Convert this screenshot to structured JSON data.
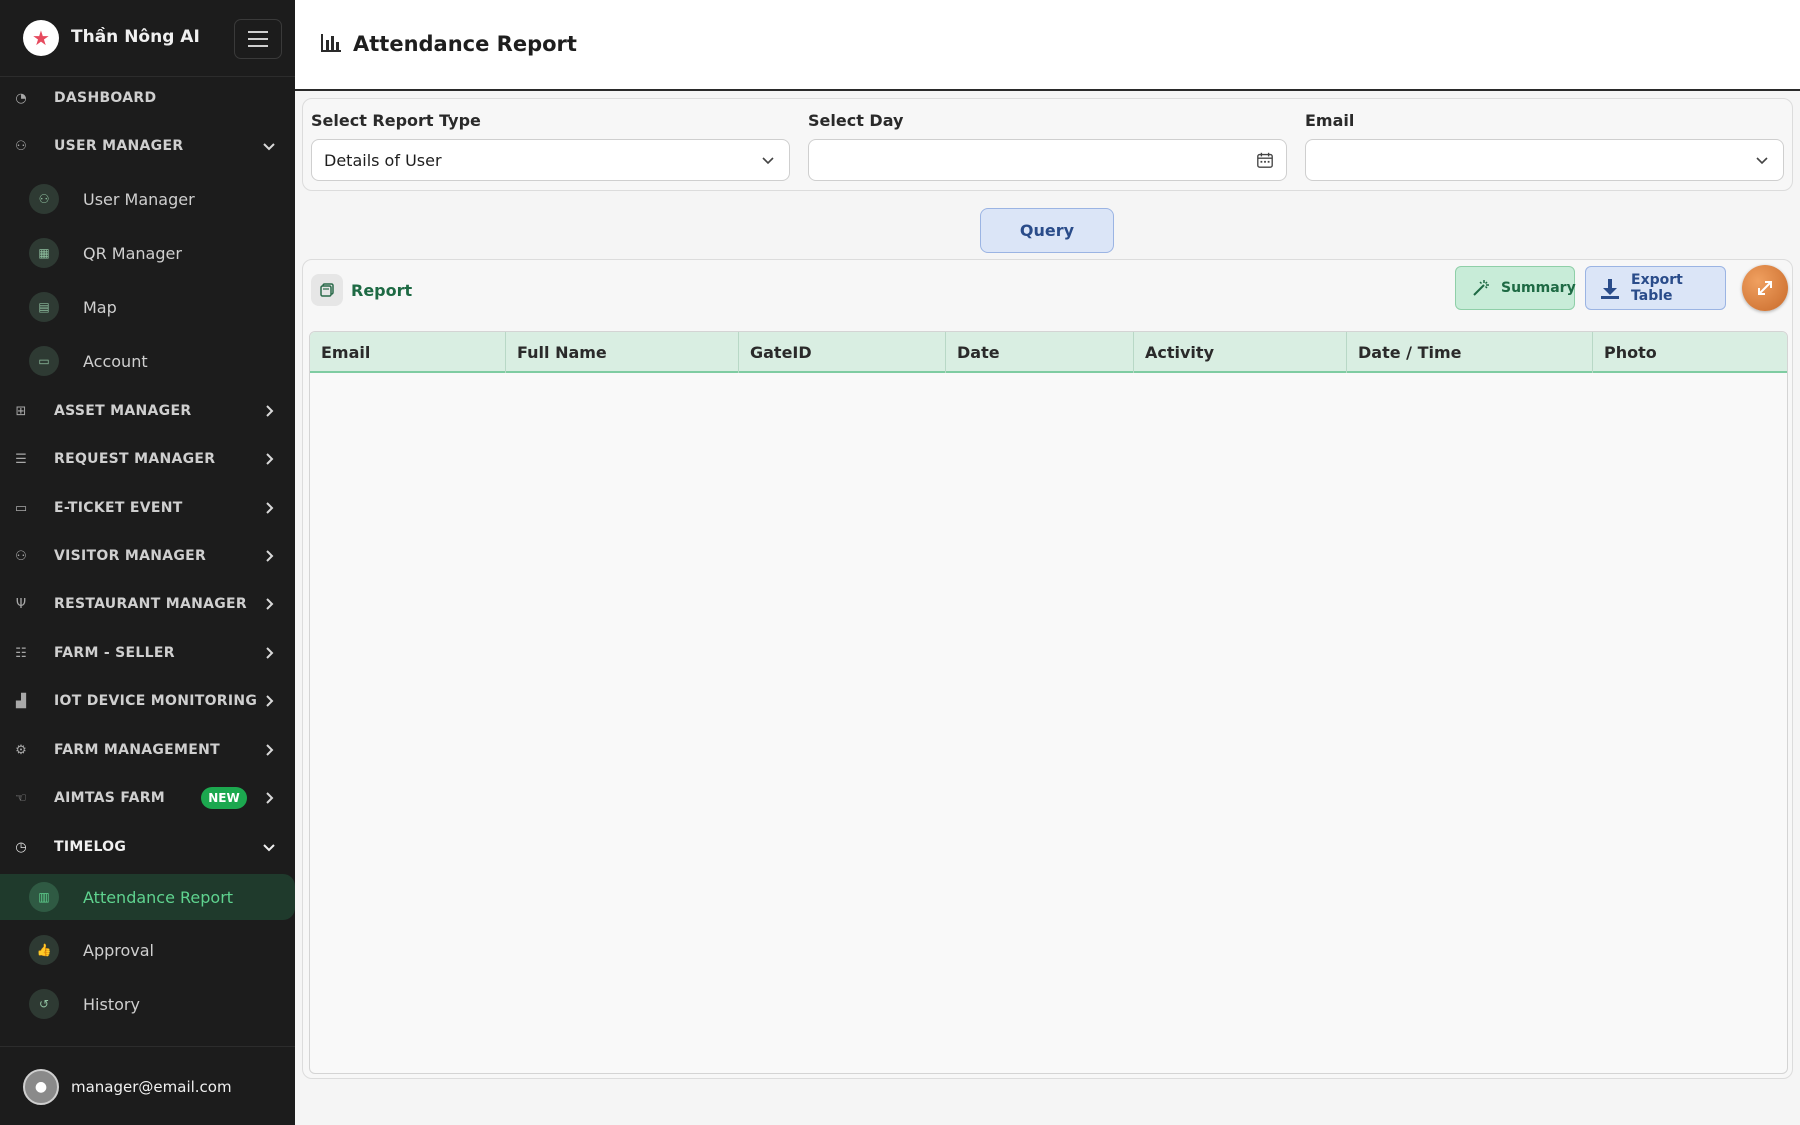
{
  "brand": {
    "name": "Thần Nông AI"
  },
  "sidebar": {
    "items": [
      {
        "label": "DASHBOARD",
        "icon": "gauge-icon"
      },
      {
        "label": "USER MANAGER",
        "icon": "users-icon",
        "expanded": true
      },
      {
        "label": "ASSET MANAGER",
        "icon": "sitemap-icon"
      },
      {
        "label": "REQUEST MANAGER",
        "icon": "clipboard-icon"
      },
      {
        "label": "E-TICKET EVENT",
        "icon": "ticket-icon"
      },
      {
        "label": "VISITOR MANAGER",
        "icon": "visitors-icon"
      },
      {
        "label": "RESTAURANT MANAGER",
        "icon": "fork-knife-icon"
      },
      {
        "label": "FARM - SELLER",
        "icon": "store-icon"
      },
      {
        "label": "IOT DEVICE MONITORING",
        "icon": "factory-icon"
      },
      {
        "label": "FARM MANAGEMENT",
        "icon": "tractor-icon"
      },
      {
        "label": "AIMTAS FARM",
        "icon": "hand-icon",
        "badge": "NEW"
      },
      {
        "label": "TIMELOG",
        "icon": "clock-icon",
        "expanded": true
      }
    ],
    "user_manager_children": [
      {
        "label": "User Manager",
        "icon": "users-icon"
      },
      {
        "label": "QR Manager",
        "icon": "qr-icon"
      },
      {
        "label": "Map",
        "icon": "map-icon"
      },
      {
        "label": "Account",
        "icon": "id-card-icon"
      }
    ],
    "timelog_children": [
      {
        "label": "Attendance Report",
        "icon": "bar-chart-icon",
        "active": true
      },
      {
        "label": "Approval",
        "icon": "thumbs-up-icon"
      },
      {
        "label": "History",
        "icon": "history-icon"
      }
    ]
  },
  "user": {
    "email": "manager@email.com"
  },
  "header": {
    "title": "Attendance Report"
  },
  "filters": {
    "report_type": {
      "label": "Select Report Type",
      "value": "Details of User"
    },
    "day": {
      "label": "Select Day",
      "value": ""
    },
    "email": {
      "label": "Email",
      "value": ""
    }
  },
  "actions": {
    "query": "Query"
  },
  "report": {
    "title": "Report",
    "summary_label": "Summary",
    "export_label": "Export Table",
    "columns": [
      "Email",
      "Full Name",
      "GateID",
      "Date",
      "Activity",
      "Date / Time",
      "Photo"
    ],
    "rows": []
  },
  "colors": {
    "sidebar_bg": "#1c1c1c",
    "active_green": "#5fd38f",
    "accent_blue": "#2a4c8a",
    "badge_green": "#1ca84f"
  }
}
